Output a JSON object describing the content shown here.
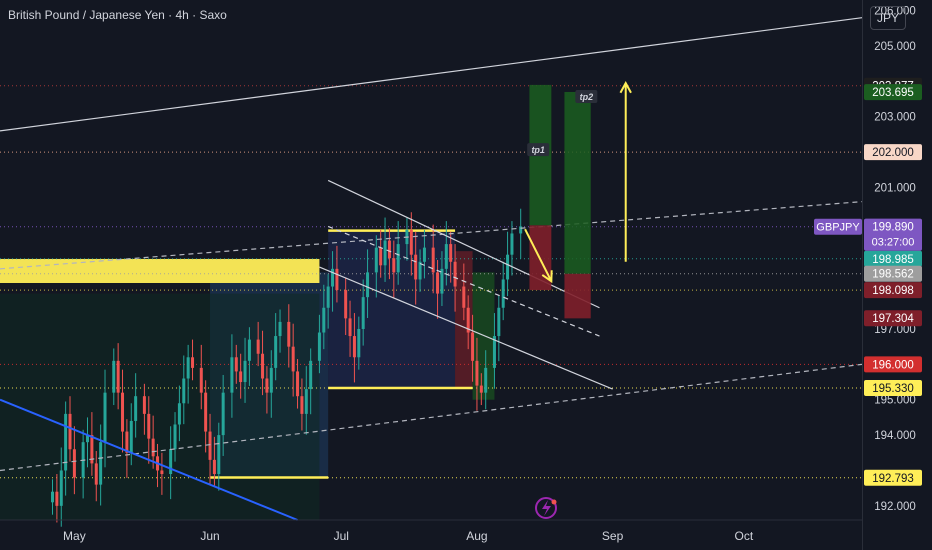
{
  "chart_title": "British Pound / Japanese Yen · 4h · Saxo",
  "currency_button": "JPY",
  "chart_data": {
    "type": "candlestick",
    "symbol": "GBPJPY",
    "interval": "4h",
    "source": "Saxo",
    "y_range": [
      191.6,
      206.3
    ],
    "y_ticks": [
      {
        "value": 192.0,
        "label": "192.000"
      },
      {
        "value": 194.0,
        "label": "194.000"
      },
      {
        "value": 195.0,
        "label": "195.000"
      },
      {
        "value": 197.0,
        "label": "197.000"
      },
      {
        "value": 201.0,
        "label": "201.000"
      },
      {
        "value": 203.0,
        "label": "203.000"
      },
      {
        "value": 205.0,
        "label": "205.000"
      },
      {
        "value": 206.0,
        "label": "206.000"
      }
    ],
    "x_range": [
      "2025-04-14",
      "2025-10-28"
    ],
    "x_ticks": [
      {
        "date": "2025-05-01",
        "label": "May"
      },
      {
        "date": "2025-06-01",
        "label": "Jun"
      },
      {
        "date": "2025-07-01",
        "label": "Jul"
      },
      {
        "date": "2025-08-01",
        "label": "Aug"
      },
      {
        "date": "2025-09-01",
        "label": "Sep"
      },
      {
        "date": "2025-10-01",
        "label": "Oct"
      }
    ],
    "price_lines": [
      {
        "value": 203.877,
        "label": "203.877",
        "bg": "#1e1e1e",
        "line": "#b23a3a",
        "style": "dotted"
      },
      {
        "value": 203.695,
        "label": "203.695",
        "bg": "#1b5e20",
        "line": null
      },
      {
        "value": 202.0,
        "label": "202.000",
        "bg": "#f8d7c7",
        "fg": "#131722",
        "line": "#e8a48a",
        "style": "dotted"
      },
      {
        "value": 199.89,
        "label": "199.890",
        "bg": "#7e57c2",
        "line": "#7e57c2",
        "style": "dotted"
      },
      {
        "value": 198.985,
        "label": "198.985",
        "bg": "#26a69a",
        "line": "#26a69a",
        "style": "dotted"
      },
      {
        "value": 198.562,
        "label": "198.562",
        "bg": "#9e9e9e",
        "line": "#9e9e9e",
        "style": "dotted"
      },
      {
        "value": 198.098,
        "label": "198.098",
        "bg": "#7f1f2a",
        "line": "#d9c64a",
        "style": "dotted"
      },
      {
        "value": 197.304,
        "label": "197.304",
        "bg": "#7f1f2a",
        "line": null
      },
      {
        "value": 196.0,
        "label": "196.000",
        "bg": "#d32f2f",
        "line": "#d32f2f",
        "style": "dotted"
      },
      {
        "value": 195.33,
        "label": "195.330",
        "bg": "#ffee58",
        "fg": "#131722",
        "line": "#ffee58",
        "style": "dotted"
      },
      {
        "value": 192.793,
        "label": "192.793",
        "bg": "#ffee58",
        "fg": "#131722",
        "line": "#ffee58",
        "style": "dotted"
      }
    ],
    "last_price": {
      "symbol_label": "GBPJPY",
      "value": 199.89,
      "label": "199.890",
      "countdown": "03:27:00"
    },
    "annotations": [
      {
        "text": "tp1",
        "date": "2025-08-15",
        "value": 202.0
      },
      {
        "text": "tp2",
        "date": "2025-08-26",
        "value": 203.5
      }
    ],
    "support_zone": {
      "from": "2025-04-14",
      "to": "2025-06-26",
      "top": 198.98,
      "bottom": 198.3,
      "color": "#ffee58"
    },
    "ranges": [
      {
        "from": "2025-06-01",
        "to": "2025-06-28",
        "top": 198.6,
        "bottom": 192.8,
        "color": "#1e3a5f"
      },
      {
        "from": "2025-06-28",
        "to": "2025-07-27",
        "top": 199.78,
        "bottom": 195.33,
        "color": "#1f2a55"
      },
      {
        "from": "2025-07-27",
        "to": "2025-07-31",
        "top": 199.2,
        "bottom": 195.3,
        "color": "#7f1f2a"
      },
      {
        "from": "2025-07-31",
        "to": "2025-08-05",
        "top": 198.6,
        "bottom": 195.0,
        "color": "#1b5e20"
      },
      {
        "from": "2025-04-14",
        "to": "2025-06-26",
        "top": 198.0,
        "bottom": 191.6,
        "color": "#0f2a22"
      }
    ],
    "positions": [
      {
        "from": "2025-08-13",
        "to": "2025-08-18",
        "entry": 199.93,
        "target": 203.9,
        "stop": 198.1
      },
      {
        "from": "2025-08-21",
        "to": "2025-08-27",
        "entry": 198.56,
        "target": 203.7,
        "stop": 197.3
      }
    ],
    "trendlines": [
      {
        "from": [
          "2025-04-14",
          202.6
        ],
        "to": [
          "2025-10-28",
          205.8
        ],
        "color": "#d1d4dc",
        "style": "solid"
      },
      {
        "from": [
          "2025-04-14",
          198.7
        ],
        "to": [
          "2025-10-28",
          200.6
        ],
        "color": "#b2b5be",
        "style": "dashed"
      },
      {
        "from": [
          "2025-04-14",
          193.0
        ],
        "to": [
          "2025-10-28",
          196.0
        ],
        "color": "#b2b5be",
        "style": "dashed"
      },
      {
        "from": [
          "2025-06-28",
          201.2
        ],
        "to": [
          "2025-08-29",
          197.6
        ],
        "color": "#d1d4dc",
        "style": "solid"
      },
      {
        "from": [
          "2025-06-28",
          199.9
        ],
        "to": [
          "2025-08-29",
          196.8
        ],
        "color": "#d1d4dc",
        "style": "dashed"
      },
      {
        "from": [
          "2025-06-26",
          198.75
        ],
        "to": [
          "2025-09-01",
          195.3
        ],
        "color": "#d1d4dc",
        "style": "solid"
      },
      {
        "from": [
          "2025-04-14",
          195.0
        ],
        "to": [
          "2025-06-21",
          191.6
        ],
        "color": "#2962ff",
        "style": "solid"
      }
    ],
    "arrows": [
      {
        "from": [
          "2025-08-12",
          199.82
        ],
        "to": [
          "2025-08-18",
          198.35
        ],
        "color": "#ffee58"
      },
      {
        "from": [
          "2025-09-04",
          198.9
        ],
        "to": [
          "2025-09-04",
          203.95
        ],
        "color": "#ffee58"
      }
    ],
    "candles_close": [
      192.4,
      192.0,
      193.0,
      194.6,
      193.6,
      192.8,
      193.8,
      194.0,
      193.2,
      192.6,
      193.8,
      195.2,
      196.1,
      195.2,
      194.1,
      193.5,
      194.4,
      195.1,
      194.6,
      193.9,
      193.4,
      193.0,
      192.9,
      193.6,
      194.3,
      194.9,
      195.6,
      196.2,
      195.9,
      195.2,
      194.1,
      193.3,
      192.9,
      194.0,
      195.2,
      196.2,
      195.8,
      195.5,
      196.1,
      196.7,
      196.3,
      195.6,
      195.2,
      195.9,
      196.8,
      197.2,
      196.5,
      195.8,
      195.1,
      194.6,
      195.3,
      196.1,
      196.9,
      197.6,
      198.2,
      198.7,
      198.1,
      197.3,
      196.8,
      196.2,
      197.0,
      197.9,
      198.6,
      199.3,
      198.8,
      199.5,
      199.0,
      198.6,
      199.4,
      199.8,
      199.1,
      198.4,
      198.9,
      199.3,
      198.6,
      198.0,
      198.7,
      199.4,
      198.9,
      198.2,
      197.6,
      196.9,
      196.1,
      195.4,
      195.2,
      195.9,
      196.8,
      197.6,
      198.4,
      199.1,
      199.7,
      199.9
    ],
    "candles_range": [
      193.0,
      199.9
    ]
  }
}
